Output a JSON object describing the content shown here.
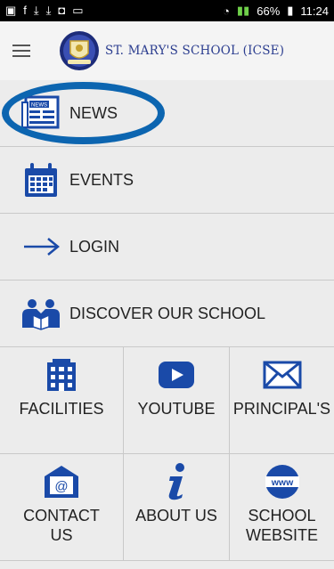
{
  "statusbar": {
    "battery": "66%",
    "time": "11:24"
  },
  "appbar": {
    "title": "ST. MARY'S SCHOOL (ICSE)"
  },
  "menu": [
    {
      "label": "NEWS",
      "icon": "news-icon"
    },
    {
      "label": "EVENTS",
      "icon": "calendar-icon"
    },
    {
      "label": "LOGIN",
      "icon": "arrow-right-icon"
    },
    {
      "label": "DISCOVER OUR SCHOOL",
      "icon": "reading-people-icon"
    }
  ],
  "tiles": [
    {
      "label": "FACILITIES",
      "icon": "building-icon"
    },
    {
      "label": "YOUTUBE",
      "icon": "youtube-play-icon"
    },
    {
      "label": "PRINCIPAL'S",
      "icon": "envelope-icon"
    },
    {
      "label": "CONTACT US",
      "icon": "email-at-icon"
    },
    {
      "label": "ABOUT US",
      "icon": "info-icon"
    },
    {
      "label": "SCHOOL WEBSITE",
      "icon": "www-globe-icon"
    }
  ],
  "colors": {
    "accent": "#1a4aa8",
    "highlight": "#0c65b0",
    "title": "#2b3d8f"
  }
}
